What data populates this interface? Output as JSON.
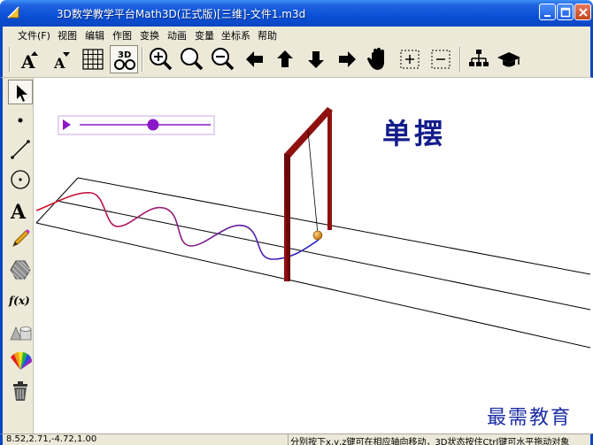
{
  "window": {
    "title": "3D数学教学平台Math3D(正式版)[三维]-文件1.m3d"
  },
  "menu": {
    "items": [
      "文件(F)",
      "视图",
      "编辑",
      "作图",
      "变换",
      "动画",
      "变量",
      "坐标系",
      "帮助"
    ]
  },
  "toolbar": {
    "buttons": [
      {
        "name": "font-larger",
        "icon": "font-larger-icon"
      },
      {
        "name": "font-smaller",
        "icon": "font-smaller-icon"
      },
      {
        "name": "grid",
        "icon": "grid-icon"
      },
      {
        "name": "3d-view",
        "icon": "3d-glasses-icon",
        "label": "3D"
      },
      {
        "name": "zoom-in",
        "icon": "zoom-in-icon"
      },
      {
        "name": "zoom-fit",
        "icon": "zoom-icon"
      },
      {
        "name": "zoom-out",
        "icon": "zoom-out-icon"
      },
      {
        "name": "move-left",
        "icon": "arrow-left-icon"
      },
      {
        "name": "move-up",
        "icon": "arrow-up-icon"
      },
      {
        "name": "move-down",
        "icon": "arrow-down-icon"
      },
      {
        "name": "move-right",
        "icon": "arrow-right-icon"
      },
      {
        "name": "pan",
        "icon": "hand-icon"
      },
      {
        "name": "add-frame",
        "icon": "dashed-plus-icon"
      },
      {
        "name": "remove-frame",
        "icon": "dashed-minus-icon"
      },
      {
        "name": "tree",
        "icon": "tree-icon"
      },
      {
        "name": "course",
        "icon": "graduation-cap-icon"
      }
    ]
  },
  "toolbox": {
    "tools": [
      "pointer",
      "point",
      "line-segment",
      "circle",
      "text",
      "pen",
      "polygon",
      "function",
      "solid",
      "color",
      "delete"
    ],
    "function_label": "f(x)",
    "text_label": "A"
  },
  "slider": {
    "value": 0.56
  },
  "scene": {
    "title": "单摆",
    "watermark": "最需教育"
  },
  "colors": {
    "title_blue": "#141d8a",
    "frame_red": "#8f1010",
    "slider_purple": "#8a18c8",
    "bob_orange": "#d88a18"
  },
  "status": {
    "coords": "8.52,2.71,-4.72,1.00",
    "hint": "分别按下x,y,z键可在相应轴向移动，3D状态按住Ctrl键可水平拖动对象"
  }
}
